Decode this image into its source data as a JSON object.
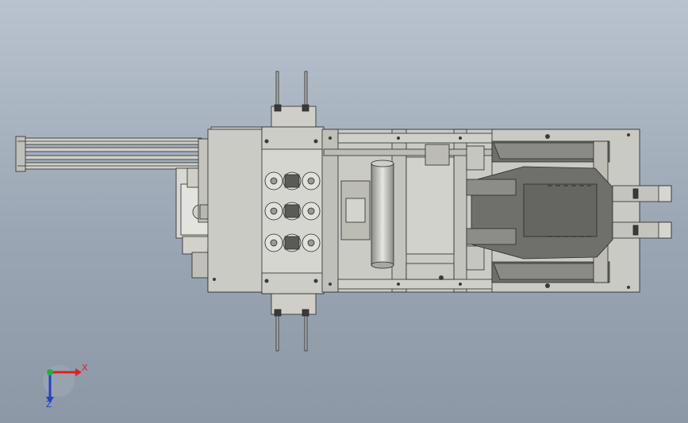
{
  "triad": {
    "x_label": "X",
    "z_label": "Z",
    "x_color": "#e02020",
    "y_color": "#20b040",
    "z_color": "#2040d0"
  },
  "colors": {
    "background_top": "#b9c3cf",
    "background_bottom": "#8c98a6",
    "part_fill": "#c8c8c2",
    "plate_fill": "#d2d2cc",
    "dark_fill": "#6e6e6a",
    "edge": "#2a2a2a"
  }
}
